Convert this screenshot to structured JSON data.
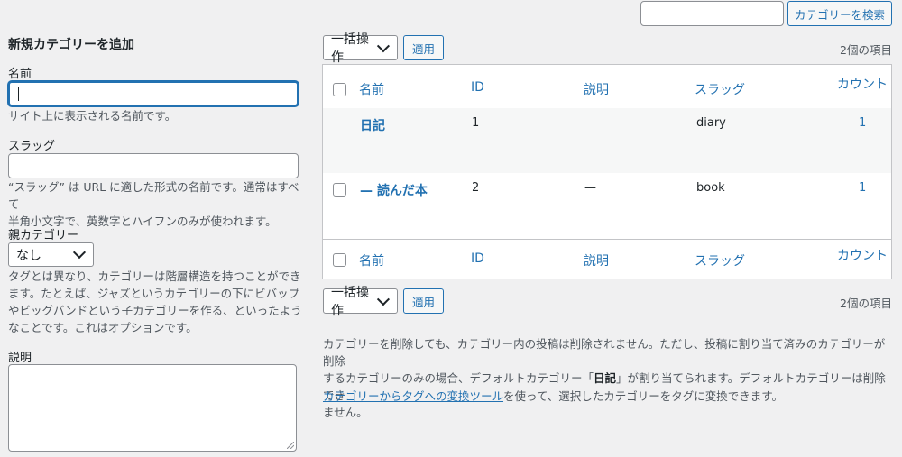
{
  "search": {
    "input_value": "",
    "button_label": "カテゴリーを検索"
  },
  "form": {
    "heading": "新規カテゴリーを追加",
    "name_label": "名前",
    "name_value": "",
    "name_desc": "サイト上に表示される名前です。",
    "slug_label": "スラッグ",
    "slug_value": "",
    "slug_desc_1": "“スラッグ” は URL に適した形式の名前です。通常はすべて",
    "slug_desc_2": "半角小文字で、英数字とハイフンのみが使われます。",
    "parent_label": "親カテゴリー",
    "parent_selected": "なし",
    "parent_desc_1": "タグとは異なり、カテゴリーは階層構造を持つことができ",
    "parent_desc_2": "ます。たとえば、ジャズというカテゴリーの下にビバップ",
    "parent_desc_3": "やビッグバンドという子カテゴリーを作る、といったよう",
    "parent_desc_4": "なことです。これはオプションです。",
    "desc_label": "説明",
    "desc_value": ""
  },
  "bulk": {
    "select_label": "一括操作",
    "apply_label": "適用",
    "item_count": "2個の項目"
  },
  "table": {
    "headers": {
      "name": "名前",
      "id": "ID",
      "description": "説明",
      "slug": "スラッグ",
      "count": "カウント"
    },
    "rows": [
      {
        "name": "日記",
        "id": "1",
        "description": "—",
        "slug": "diary",
        "count": "1"
      },
      {
        "name": "— 読んだ本",
        "id": "2",
        "description": "—",
        "slug": "book",
        "count": "1"
      }
    ]
  },
  "notice": {
    "line1": "カテゴリーを削除しても、カテゴリー内の投稿は削除されません。ただし、投稿に割り当て済みのカテゴリーが削除",
    "line2_a": "するカテゴリーのみの場合、デフォルトカテゴリー「",
    "line2_bold": "日記",
    "line2_b": "」が割り当てられます。デフォルトカテゴリーは削除でき",
    "line3": "ません。",
    "link_text": "カテゴリーからタグへの変換ツール",
    "link_suffix": "を使って、選択したカテゴリーをタグに変換できます。"
  },
  "colors": {
    "accent": "#2271b1",
    "background": "#f0f0f1",
    "text": "#1d2327"
  }
}
